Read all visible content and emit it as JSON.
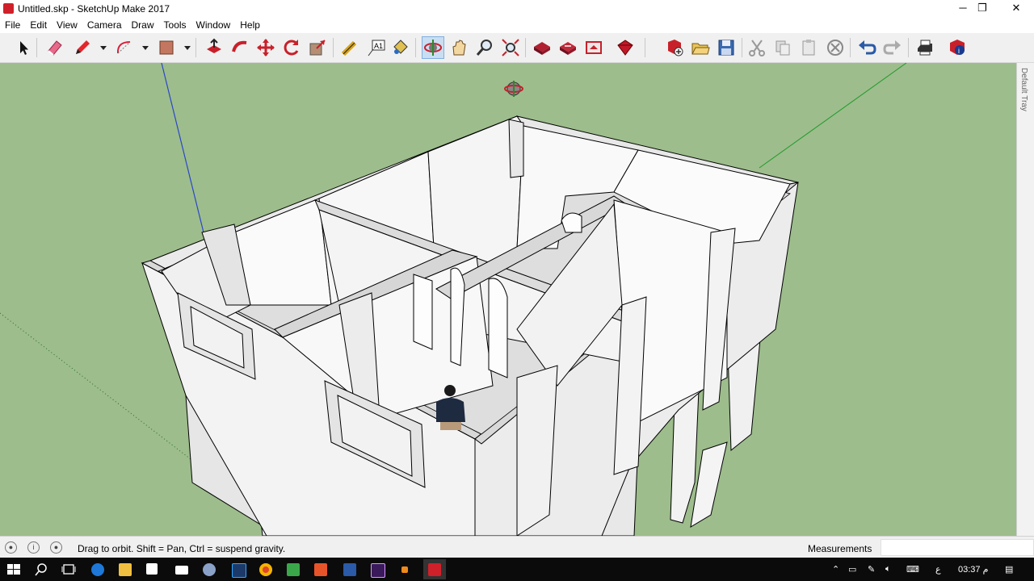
{
  "window": {
    "title": "Untitled.skp - SketchUp Make 2017",
    "minimize_glyph": "─",
    "restore_glyph": "❐",
    "close_glyph": "✕"
  },
  "menu": [
    "File",
    "Edit",
    "View",
    "Camera",
    "Draw",
    "Tools",
    "Window",
    "Help"
  ],
  "toolbar": {
    "tools": [
      "select",
      "eraser",
      "pencil",
      "arc",
      "rectangle",
      "push-pull",
      "follow-me",
      "move",
      "rotate",
      "scale",
      "tape-measure",
      "text",
      "paint-bucket",
      "orbit",
      "pan",
      "zoom",
      "zoom-extents",
      "warehouse",
      "share-model",
      "extension-warehouse",
      "extension-manager",
      "new",
      "open",
      "save",
      "cut",
      "copy",
      "paste",
      "erase",
      "undo",
      "redo",
      "print",
      "model-info"
    ],
    "active_tool": "orbit"
  },
  "tray": {
    "label": "Default Tray"
  },
  "status": {
    "hint": "Drag to orbit. Shift = Pan, Ctrl = suspend gravity.",
    "measurements_label": "Measurements",
    "measurements_value": ""
  },
  "taskbar": {
    "input_lang": "ع",
    "clock": "03:37 م"
  },
  "colors": {
    "viewport_bg": "#9dbd8c",
    "wall_face": "#f2f2f2",
    "wall_shade": "#d6d6d6",
    "axis_blue": "#2a47c9",
    "axis_green": "#1f9a2a"
  }
}
